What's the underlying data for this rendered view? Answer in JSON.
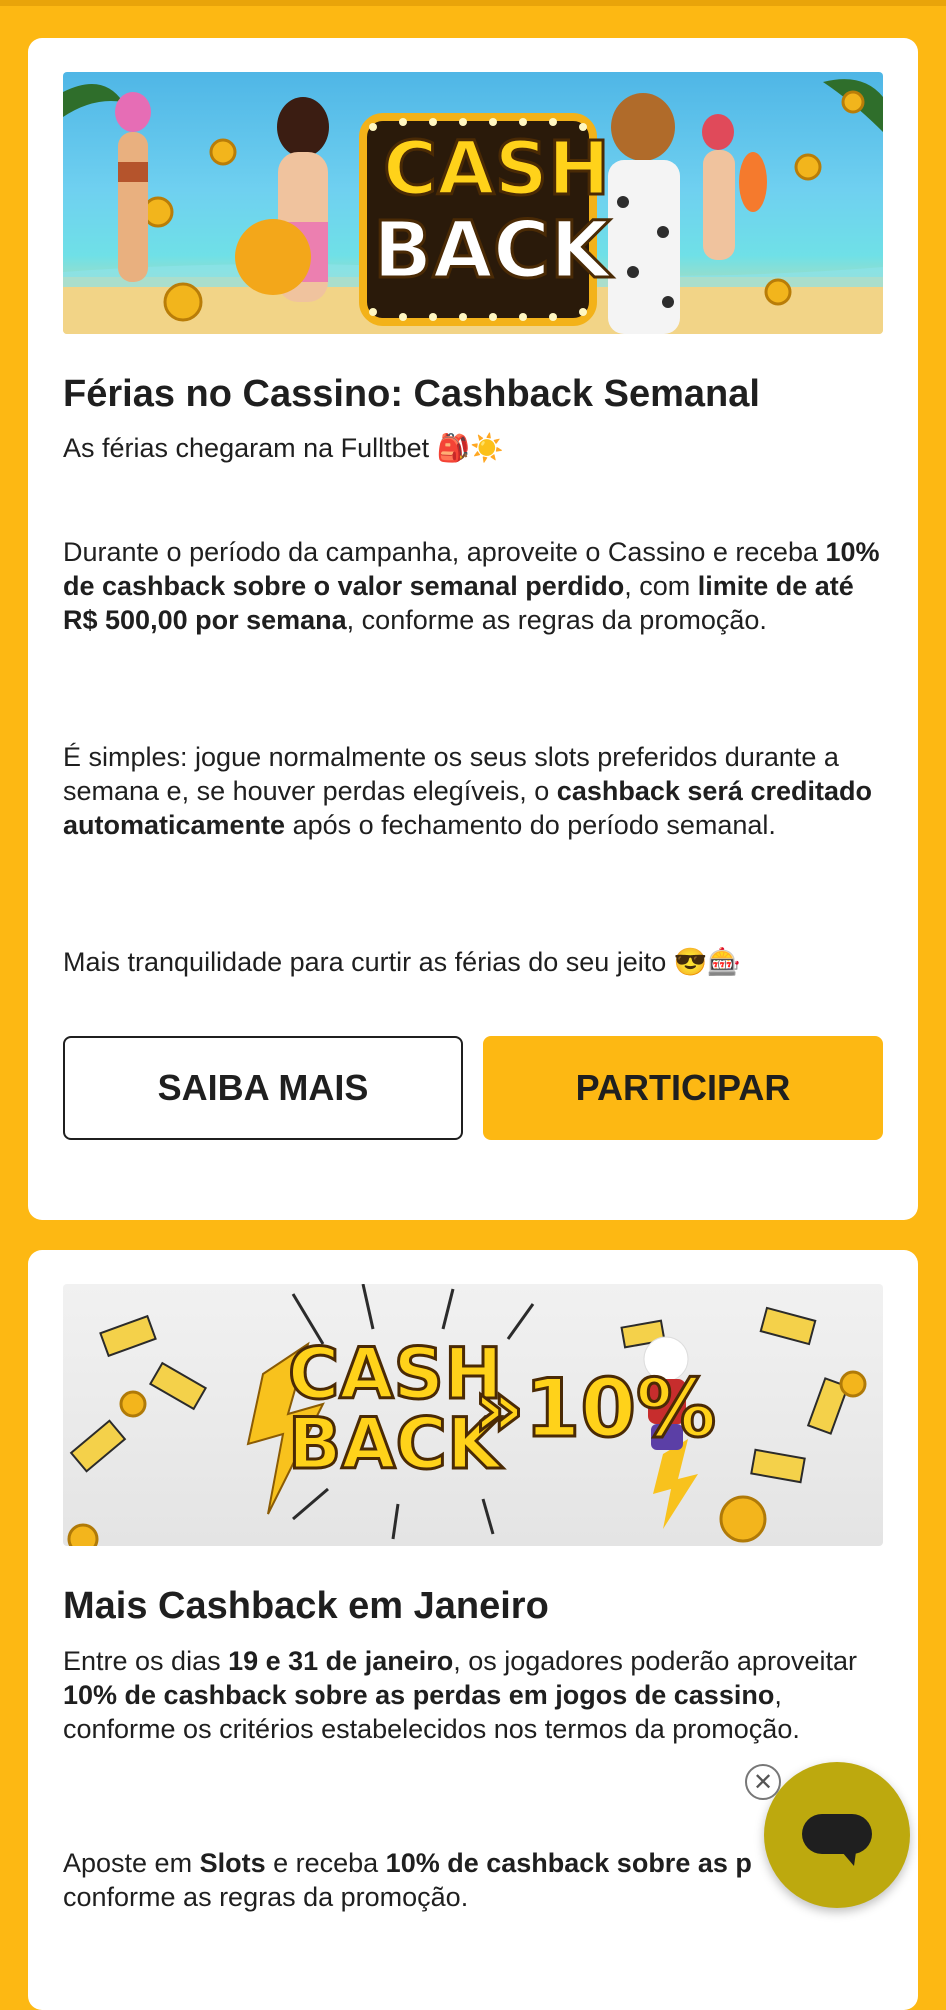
{
  "promo1": {
    "banner_text_top": "CASH",
    "banner_text_bottom": "BACK",
    "title": "Férias no Cassino: Cashback Semanal",
    "subtitle": "As férias chegaram na Fulltbet 🎒☀️",
    "p1": {
      "t1": "Durante o período da campanha, aproveite o Cassino e receba ",
      "b1": "10% de cashback sobre o valor semanal perdido",
      "t2": ", com ",
      "b2": "limite de até R$ 500,00 por semana",
      "t3": ", conforme as regras da promoção."
    },
    "p2": {
      "t1": "É simples: jogue normalmente os seus slots preferidos durante a semana e, se houver perdas elegíveis, o ",
      "b1": "cashback será creditado automaticamente",
      "t2": " após o fechamento do período semanal."
    },
    "p3": "Mais tranquilidade para curtir as férias do seu jeito 😎🎰",
    "btn_more": "SAIBA MAIS",
    "btn_join": "PARTICIPAR"
  },
  "promo2": {
    "banner_text_top": "CASH",
    "banner_text_bottom": "BACK",
    "banner_percent": "»10%",
    "title": "Mais Cashback em Janeiro",
    "p1": {
      "t1": "Entre os dias ",
      "b1": "19 e 31 de janeiro",
      "t2": ", os jogadores poderão aproveitar ",
      "b2": "10% de cashback sobre as perdas em jogos de cassino",
      "t3": ", conforme os critérios estabelecidos nos termos da promoção."
    },
    "p2": {
      "t1": "Aposte em ",
      "b1": "Slots",
      "t2": " e receba ",
      "b2": "10% de cashback sobre as p",
      "t3": "conforme as regras da promoção."
    }
  },
  "chat": {
    "close_glyph": "✕",
    "icon": "chat-bubble-icon"
  },
  "colors": {
    "brand_yellow": "#FDB813",
    "chat_button": "#bda90e",
    "text": "#1f1f1f"
  }
}
